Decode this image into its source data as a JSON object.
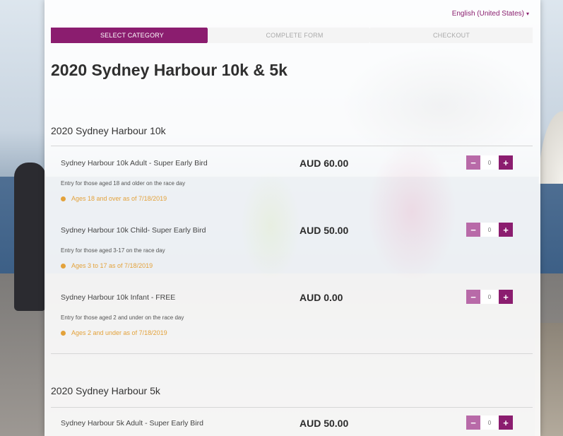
{
  "language": {
    "label": "English (United States)"
  },
  "steps": [
    {
      "label": "SELECT CATEGORY"
    },
    {
      "label": "COMPLETE FORM"
    },
    {
      "label": "CHECKOUT"
    }
  ],
  "event_title": "2020 Sydney Harbour 10k & 5k",
  "sections": [
    {
      "title": "2020 Sydney Harbour 10k",
      "tickets": [
        {
          "name": "Sydney Harbour 10k Adult - Super Early Bird",
          "price": "AUD 60.00",
          "description": "Entry for those aged 18 and older on the race day",
          "age": "Ages 18 and over as of 7/18/2019",
          "quantity": "0"
        },
        {
          "name": "Sydney Harbour 10k Child- Super Early Bird",
          "price": "AUD 50.00",
          "description": "Entry for those aged 3-17 on the race day",
          "age": "Ages 3 to 17 as of 7/18/2019",
          "quantity": "0"
        },
        {
          "name": "Sydney Harbour 10k Infant - FREE",
          "price": "AUD 0.00",
          "description": "Entry for those aged 2 and under on the race day",
          "age": "Ages 2 and under as of 7/18/2019",
          "quantity": "0"
        }
      ]
    },
    {
      "title": "2020 Sydney Harbour 5k",
      "tickets": [
        {
          "name": "Sydney Harbour 5k Adult - Super Early Bird",
          "price": "AUD 50.00",
          "quantity": "0"
        }
      ]
    }
  ],
  "stepper": {
    "minus": "−",
    "plus": "+"
  },
  "icons": {
    "caret": "caret-down-icon",
    "dot": "age-dot-icon"
  },
  "colors": {
    "brand": "#8b1d6f",
    "brand_light": "#b86aa8",
    "age_text": "#e3a23b"
  }
}
